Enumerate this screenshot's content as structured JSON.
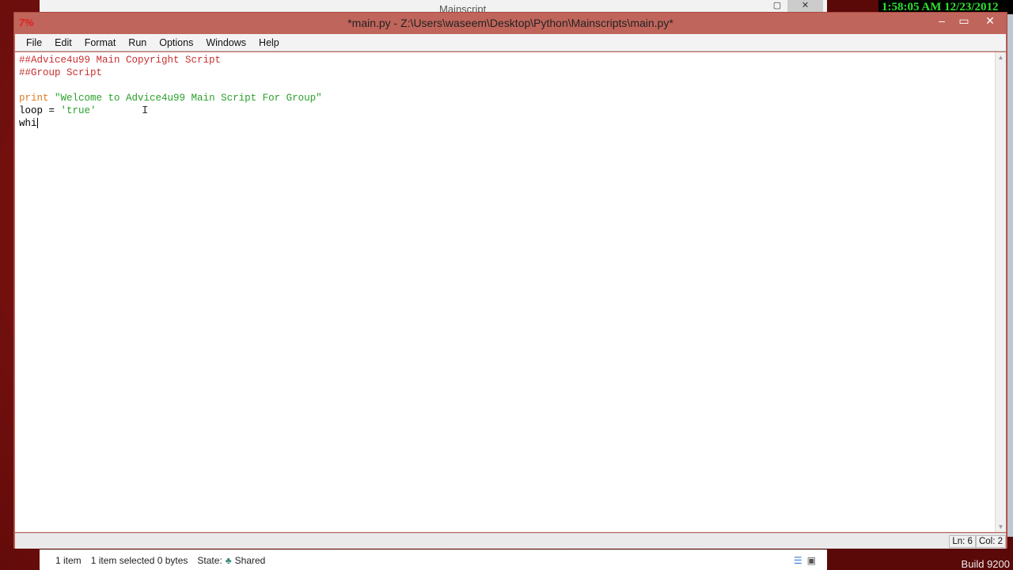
{
  "background_window": {
    "title": "Mainscript",
    "close_icon": "close-icon",
    "maximize_icon": "maximize-icon"
  },
  "clock": {
    "text": "1:58:05 AM 12/23/2012"
  },
  "idle_window": {
    "title": "*main.py - Z:\\Users\\waseem\\Desktop\\Python\\Mainscripts\\main.py*",
    "app_icon": "7%",
    "menu": [
      "File",
      "Edit",
      "Format",
      "Run",
      "Options",
      "Windows",
      "Help"
    ],
    "code": {
      "line1": "##Advice4u99 Main Copyright Script",
      "line2": "##Group Script",
      "line4_kw": "print",
      "line4_str": "\"Welcome to Advice4u99 Main Script For Group\"",
      "line5_var": "loop = ",
      "line5_str": "'true'",
      "line6": "whi"
    },
    "status": {
      "ln": "Ln: 6",
      "col": "Col: 2"
    },
    "colors": {
      "titlebar": "#c0655b",
      "comment": "#c83030",
      "keyword": "#e07b20",
      "string": "#2aa02a"
    }
  },
  "explorer_status": {
    "items": "1 item",
    "selected": "1 item selected  0 bytes",
    "state_label": "State:",
    "state_value": "Shared"
  },
  "desktop": {
    "build": "Build 9200"
  }
}
